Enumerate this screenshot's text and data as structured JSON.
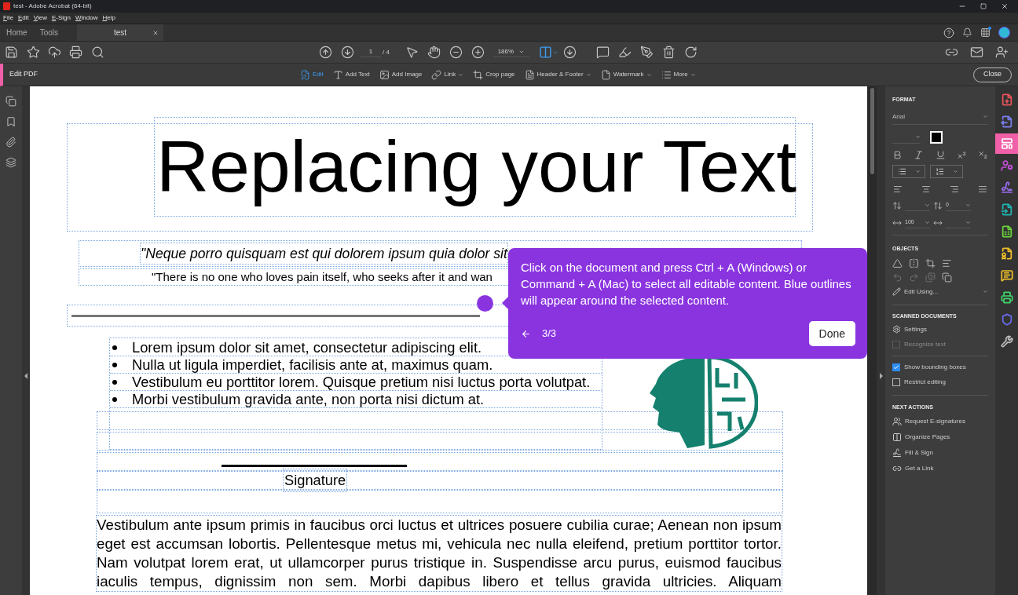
{
  "window": {
    "title": "test - Adobe Acrobat (64-bit)"
  },
  "menu_bar": [
    "File",
    "Edit",
    "View",
    "E-Sign",
    "Window",
    "Help"
  ],
  "tabs": [
    {
      "label": "Home",
      "selected": false
    },
    {
      "label": "Tools",
      "selected": false
    },
    {
      "label": "test",
      "selected": true
    }
  ],
  "toolbar": {
    "page_number": "1",
    "page_total": "/ 4",
    "zoom": "186%"
  },
  "edit_toolbar": {
    "title": "Edit PDF",
    "tools": [
      {
        "label": "Edit",
        "selected": true,
        "has_menu": false
      },
      {
        "label": "Add Text",
        "selected": false,
        "has_menu": false
      },
      {
        "label": "Add Image",
        "selected": false,
        "has_menu": false
      },
      {
        "label": "Link",
        "selected": false,
        "has_menu": true
      },
      {
        "label": "Crop page",
        "selected": false,
        "has_menu": false
      },
      {
        "label": "Header & Footer",
        "selected": false,
        "has_menu": true
      },
      {
        "label": "Watermark",
        "selected": false,
        "has_menu": true
      },
      {
        "label": "More",
        "selected": false,
        "has_menu": true
      }
    ],
    "close_button": "Close"
  },
  "document": {
    "title": "Replacing your Text",
    "quote": "\"Neque porro quisquam est qui dolorem ipsum quia dolor sit",
    "subquote": "\"There is no one who loves pain itself, who seeks after it and wan",
    "bullets": [
      "Lorem ipsum dolor sit amet, consectetur adipiscing elit.",
      "Nulla ut ligula imperdiet, facilisis ante at, maximus quam.",
      "Vestibulum eu porttitor lorem. Quisque pretium nisi luctus porta volutpat.",
      "Morbi vestibulum gravida ante, non porta nisi dictum at."
    ],
    "signature_label": "Signature",
    "paragraph": "Vestibulum ante ipsum primis in faucibus orci luctus et ultrices posuere cubilia curae; Aenean non ipsum eget est accumsan lobortis. Pellentesque metus mi, vehicula nec nulla eleifend, pretium porttitor tortor. Nam volutpat lorem erat, ut ullamcorper purus tristique in. Suspendisse arcu purus, euismod faucibus iaculis tempus, dignissim non sem. Morbi dapibus libero et tellus gravida ultricies. Aliquam"
  },
  "popover": {
    "text": "Click on the document and press Ctrl + A (Windows) or Command + A (Mac) to select all editable content. Blue outlines will appear around the selected content.",
    "step": "3/3",
    "button": "Done"
  },
  "format": {
    "heading": "FORMAT",
    "font": "Arial",
    "line_spacing": "0",
    "scale": "100"
  },
  "objects": {
    "heading": "OBJECTS",
    "edit_using": "Edit Using..."
  },
  "scanned": {
    "heading": "SCANNED DOCUMENTS",
    "settings": "Settings",
    "recognize": {
      "label": "Recognize text",
      "checked": false,
      "disabled": true
    }
  },
  "options": [
    {
      "label": "Show bounding boxes",
      "checked": true
    },
    {
      "label": "Restrict editing",
      "checked": false
    }
  ],
  "next_actions": {
    "heading": "NEXT ACTIONS",
    "items": [
      "Request E-signatures",
      "Organize Pages",
      "Fill & Sign",
      "Get a Link"
    ]
  },
  "right_rail": [
    {
      "color": "#e8545c",
      "selected": false
    },
    {
      "color": "#7b7ff0",
      "selected": false
    },
    {
      "color": "#f05fa8",
      "selected": true
    },
    {
      "color": "#c24fd6",
      "selected": false
    },
    {
      "color": "#9b6cf0",
      "selected": false
    },
    {
      "color": "#1fb5b0",
      "selected": false
    },
    {
      "color": "#6bd43c",
      "selected": false
    },
    {
      "color": "#f0c02a",
      "selected": false
    },
    {
      "color": "#f0c02a",
      "selected": false
    },
    {
      "color": "#3fd46a",
      "selected": false
    },
    {
      "color": "#6b6cf0",
      "selected": false
    },
    {
      "color": "#bdbdbd",
      "selected": false
    }
  ]
}
